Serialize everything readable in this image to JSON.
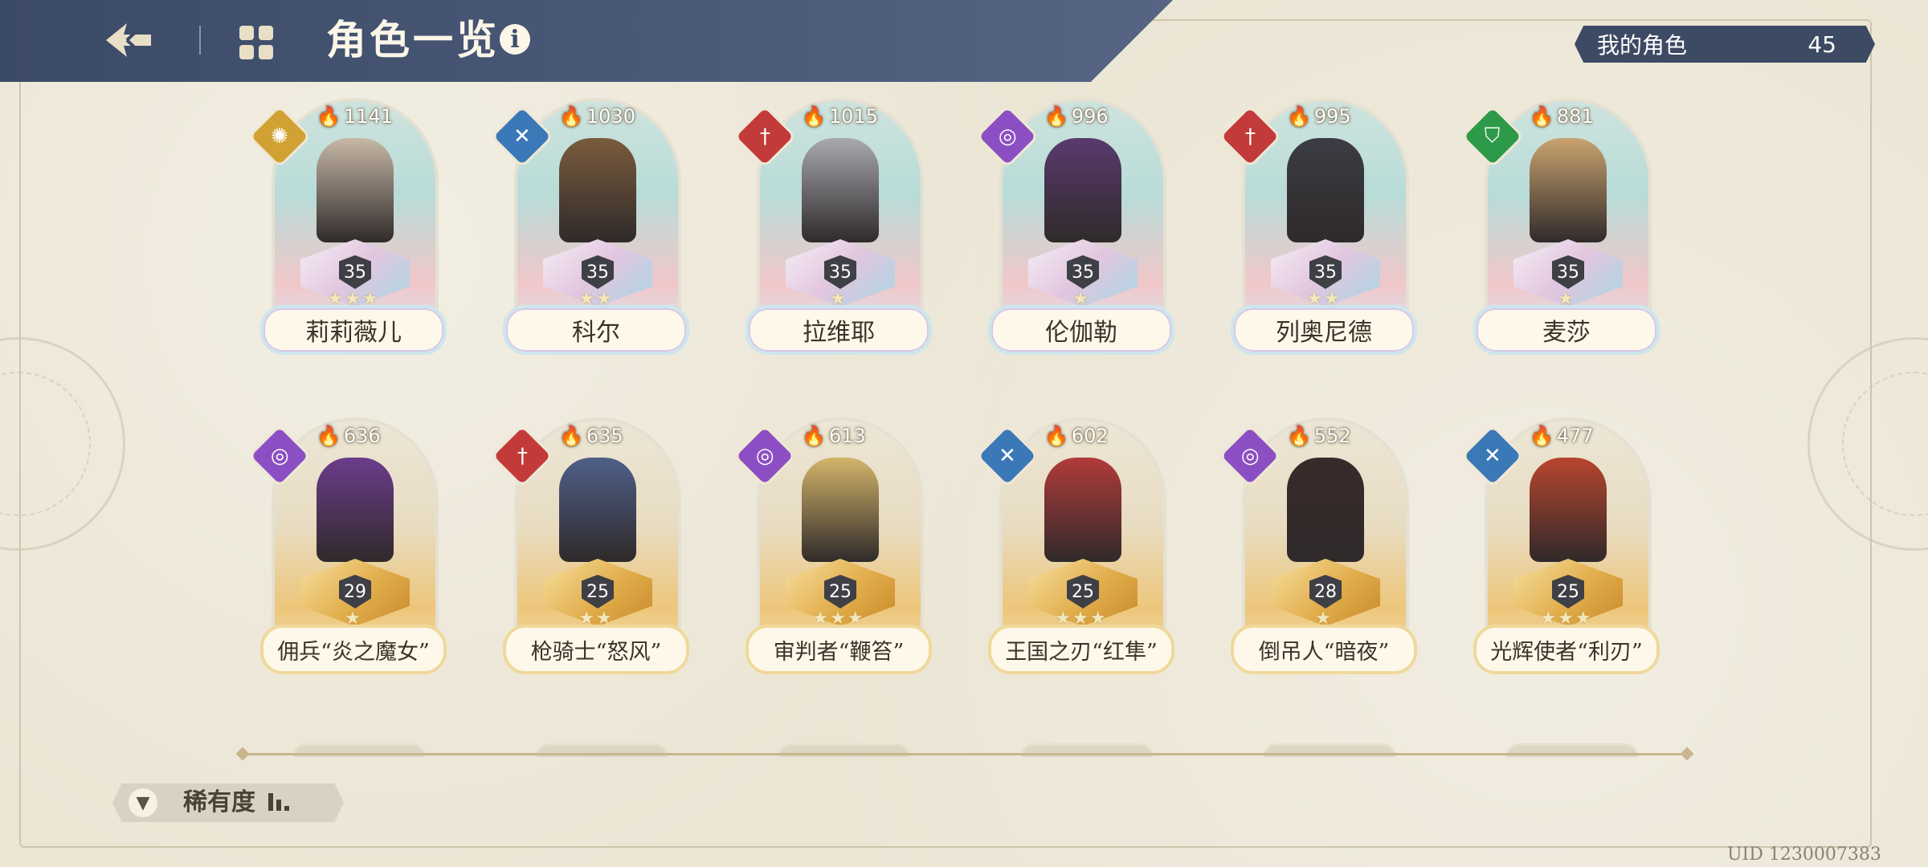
{
  "header": {
    "title": "角色一览",
    "info_icon": "info-icon",
    "back_icon": "back-arrow-icon",
    "menu_icon": "grid-menu-icon"
  },
  "my_characters": {
    "label": "我的角色",
    "count": "45"
  },
  "colors": {
    "header_bg": "#3b4a66",
    "ur_rarity": "#bfe0dc",
    "r_rarity": "#e8b457",
    "class_gold": "#d1a233",
    "class_blue": "#3b78b7",
    "class_red": "#c23a3a",
    "class_purple": "#8c4fc3",
    "class_green": "#2d9a4a"
  },
  "characters": [
    {
      "name": "莉莉薇儿",
      "power": "1141",
      "level": "35",
      "stars": "★★★",
      "rarity": "ur",
      "class_color": "#d1a233",
      "class_icon": "sun-icon"
    },
    {
      "name": "科尔",
      "power": "1030",
      "level": "35",
      "stars": "★★",
      "rarity": "ur",
      "class_color": "#3b78b7",
      "class_icon": "crossed-swords-icon"
    },
    {
      "name": "拉维耶",
      "power": "1015",
      "level": "35",
      "stars": "★",
      "rarity": "ur",
      "class_color": "#c23a3a",
      "class_icon": "sword-icon"
    },
    {
      "name": "伦伽勒",
      "power": "996",
      "level": "35",
      "stars": "★",
      "rarity": "ur",
      "class_color": "#8c4fc3",
      "class_icon": "magic-swirl-icon"
    },
    {
      "name": "列奥尼德",
      "power": "995",
      "level": "35",
      "stars": "★★",
      "rarity": "ur",
      "class_color": "#c23a3a",
      "class_icon": "sword-icon"
    },
    {
      "name": "麦莎",
      "power": "881",
      "level": "35",
      "stars": "★",
      "rarity": "ur",
      "class_color": "#2d9a4a",
      "class_icon": "shield-icon"
    },
    {
      "name": "佣兵“炎之魔女”",
      "power": "636",
      "level": "29",
      "stars": "★",
      "rarity": "r",
      "class_color": "#8c4fc3",
      "class_icon": "magic-swirl-icon"
    },
    {
      "name": "枪骑士“怒风”",
      "power": "635",
      "level": "25",
      "stars": "★★",
      "rarity": "r",
      "class_color": "#c23a3a",
      "class_icon": "sword-icon"
    },
    {
      "name": "审判者“鞭笞”",
      "power": "613",
      "level": "25",
      "stars": "★★★",
      "rarity": "r",
      "class_color": "#8c4fc3",
      "class_icon": "magic-swirl-icon"
    },
    {
      "name": "王国之刃“红隼”",
      "power": "602",
      "level": "25",
      "stars": "★★★",
      "rarity": "r",
      "class_color": "#3b78b7",
      "class_icon": "crossed-swords-icon"
    },
    {
      "name": "倒吊人“暗夜”",
      "power": "552",
      "level": "28",
      "stars": "★",
      "rarity": "r",
      "class_color": "#8c4fc3",
      "class_icon": "magic-swirl-icon"
    },
    {
      "name": "光辉使者“利刃”",
      "power": "477",
      "level": "25",
      "stars": "★★★",
      "rarity": "r",
      "class_color": "#3b78b7",
      "class_icon": "crossed-swords-icon"
    }
  ],
  "filter": {
    "label": "稀有度",
    "icon": "filter-icon",
    "sort_icon": "sort-bars-icon"
  },
  "uid": "UID 1230007383"
}
